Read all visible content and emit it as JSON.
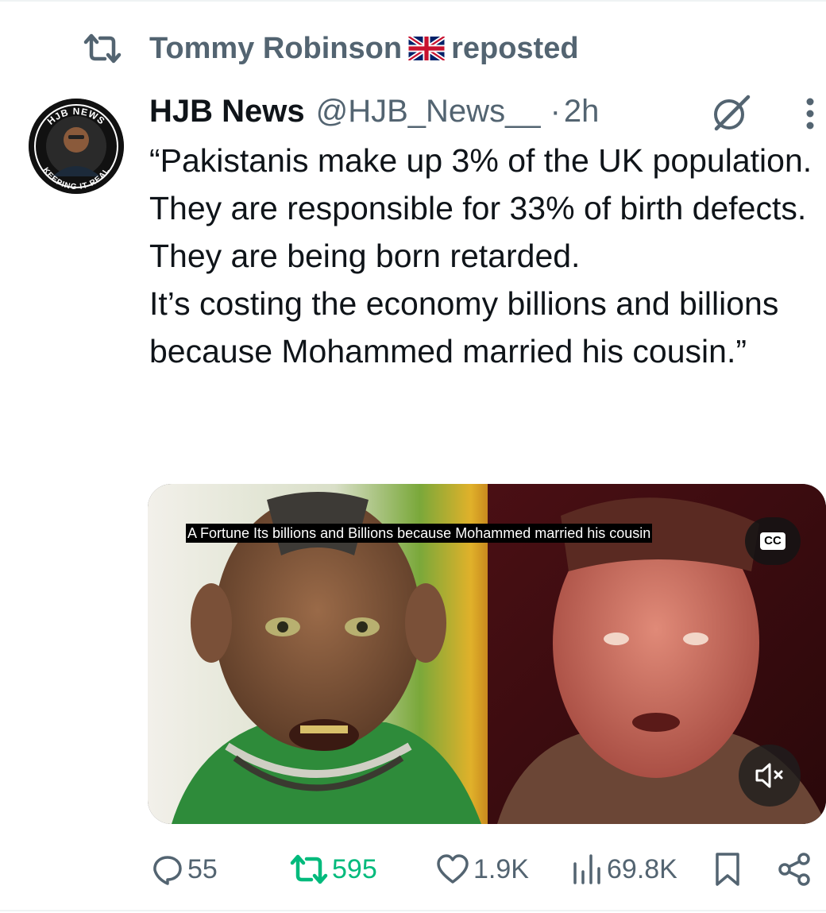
{
  "repost_header": {
    "name": "Tommy Robinson",
    "flag_icon": "uk-flag-icon",
    "suffix": "reposted"
  },
  "tweet": {
    "author_name": "HJB News",
    "handle": "@HJB_News__",
    "separator": "·",
    "time": "2h",
    "avatar_texts": {
      "top": "HJB NEWS",
      "bottom": "KEEPING IT REAL"
    },
    "text": "“Pakistanis make up 3% of the UK population. They are responsible for 33% of birth defects. They are being born retarded.\nIt’s costing the economy billions and billions because Mohammed married his cousin.”"
  },
  "media": {
    "caption": "A Fortune Its billions and Billions because Mohammed married his cousin",
    "cc_label": "CC",
    "mute_icon": "speaker-muted-icon"
  },
  "actions": {
    "replies": "55",
    "reposts": "595",
    "likes": "1.9K",
    "views": "69.8K"
  },
  "colors": {
    "secondary_text": "#536471",
    "repost_green": "#00ba7c",
    "primary_text": "#0f1419"
  }
}
